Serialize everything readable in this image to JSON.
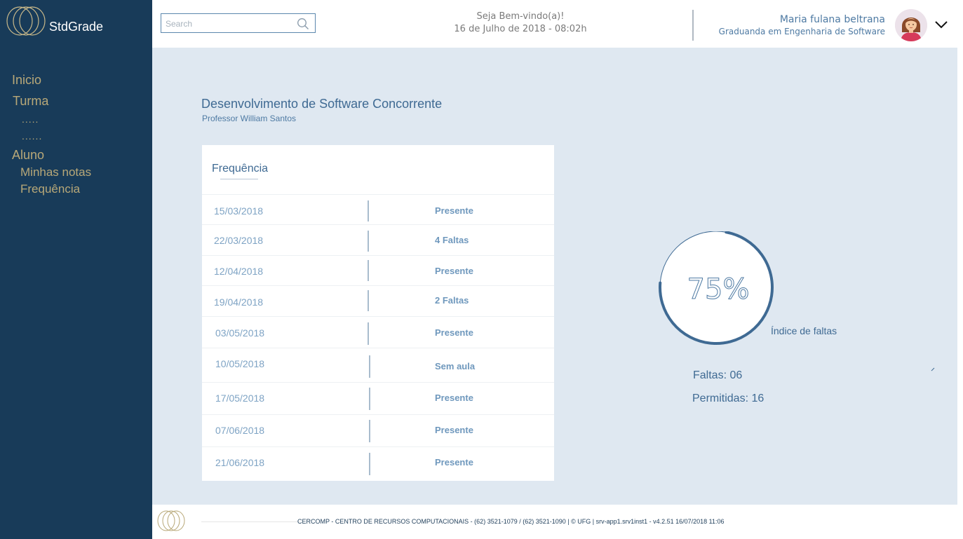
{
  "app": {
    "brand": "StdGrade"
  },
  "sidebar": {
    "items": [
      {
        "label": "Inicio"
      },
      {
        "label": "Turma"
      },
      {
        "label": "....."
      },
      {
        "label": "......"
      },
      {
        "label": "Aluno"
      },
      {
        "label": "Minhas notas"
      },
      {
        "label": "Frequência"
      }
    ]
  },
  "header": {
    "search_placeholder": "Search",
    "welcome": "Seja Bem-vindo(a)!",
    "datetime": "16 de Julho de 2018 - 08:02h",
    "user_name": "Maria fulana beltrana",
    "user_role": "Graduanda em Engenharia de Software"
  },
  "course": {
    "title": "Desenvolvimento de Software Concorrente",
    "professor": "Professor William Santos"
  },
  "attendance": {
    "title": "Frequência",
    "rows": [
      {
        "date": "15/03/2018",
        "status": "Presente"
      },
      {
        "date": "22/03/2018",
        "status": "4 Faltas"
      },
      {
        "date": "12/04/2018",
        "status": "Presente"
      },
      {
        "date": "19/04/2018",
        "status": "2 Faltas"
      },
      {
        "date": "03/05/2018",
        "status": "Presente"
      },
      {
        "date": "10/05/2018",
        "status": "Sem aula"
      },
      {
        "date": "17/05/2018",
        "status": "Presente"
      },
      {
        "date": "07/06/2018",
        "status": "Presente"
      },
      {
        "date": "21/06/2018",
        "status": "Presente"
      }
    ]
  },
  "summary": {
    "percent_label": "75%",
    "percent_value": 0.75,
    "index_label": "Índice de faltas",
    "faltas": "Faltas: 06",
    "permitidas": "Permitidas: 16"
  },
  "footer": {
    "text": "CERCOMP - CENTRO DE RECURSOS COMPUTACIONAIS - (62) 3521-1079 / (62) 3521-1090 | © UFG | srv-app1.srv1inst1 - v4.2.51 16/07/2018 11:06"
  },
  "colors": {
    "sidebar_bg": "#183b59",
    "nav_text": "#b8a878",
    "accent_blue": "#3f6a93",
    "main_bg": "#dfe8f1",
    "gauge_stroke": "#3f6a93"
  }
}
